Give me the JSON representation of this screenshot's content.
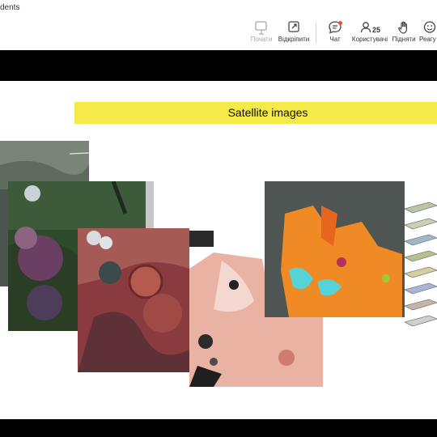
{
  "window": {
    "title": "dents"
  },
  "toolbar": {
    "start_label": "Почати",
    "unpin_label": "Відкріпити",
    "chat_label": "Чат",
    "users_label": "Користувачі",
    "users_count": "25",
    "raise_label": "Підняти",
    "react_label": "Реагу"
  },
  "slide": {
    "title": "Satellite images"
  },
  "colors": {
    "title_band": "#f6e94a",
    "chat_badge": "#e0513a",
    "frame": "#000000"
  }
}
